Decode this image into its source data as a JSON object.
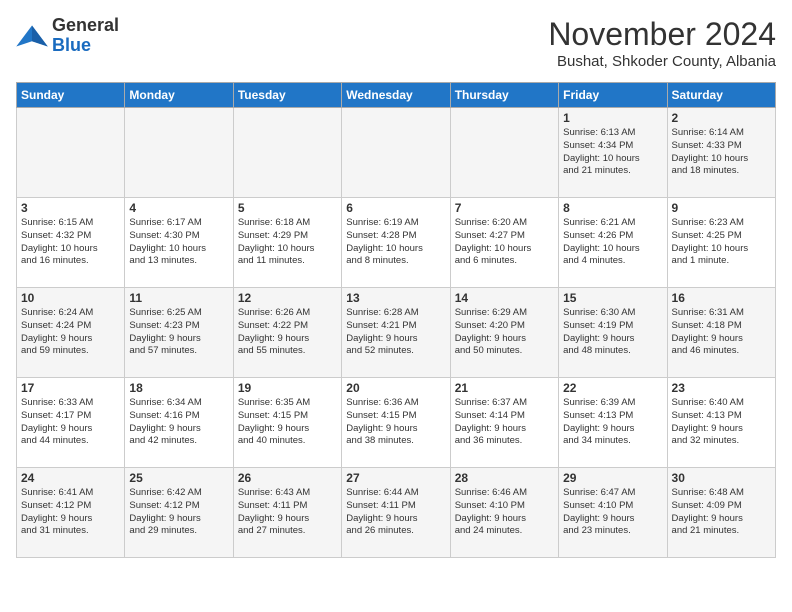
{
  "header": {
    "logo_line1": "General",
    "logo_line2": "Blue",
    "month_year": "November 2024",
    "location": "Bushat, Shkoder County, Albania"
  },
  "days_of_week": [
    "Sunday",
    "Monday",
    "Tuesday",
    "Wednesday",
    "Thursday",
    "Friday",
    "Saturday"
  ],
  "weeks": [
    [
      {
        "day": "",
        "info": ""
      },
      {
        "day": "",
        "info": ""
      },
      {
        "day": "",
        "info": ""
      },
      {
        "day": "",
        "info": ""
      },
      {
        "day": "",
        "info": ""
      },
      {
        "day": "1",
        "info": "Sunrise: 6:13 AM\nSunset: 4:34 PM\nDaylight: 10 hours\nand 21 minutes."
      },
      {
        "day": "2",
        "info": "Sunrise: 6:14 AM\nSunset: 4:33 PM\nDaylight: 10 hours\nand 18 minutes."
      }
    ],
    [
      {
        "day": "3",
        "info": "Sunrise: 6:15 AM\nSunset: 4:32 PM\nDaylight: 10 hours\nand 16 minutes."
      },
      {
        "day": "4",
        "info": "Sunrise: 6:17 AM\nSunset: 4:30 PM\nDaylight: 10 hours\nand 13 minutes."
      },
      {
        "day": "5",
        "info": "Sunrise: 6:18 AM\nSunset: 4:29 PM\nDaylight: 10 hours\nand 11 minutes."
      },
      {
        "day": "6",
        "info": "Sunrise: 6:19 AM\nSunset: 4:28 PM\nDaylight: 10 hours\nand 8 minutes."
      },
      {
        "day": "7",
        "info": "Sunrise: 6:20 AM\nSunset: 4:27 PM\nDaylight: 10 hours\nand 6 minutes."
      },
      {
        "day": "8",
        "info": "Sunrise: 6:21 AM\nSunset: 4:26 PM\nDaylight: 10 hours\nand 4 minutes."
      },
      {
        "day": "9",
        "info": "Sunrise: 6:23 AM\nSunset: 4:25 PM\nDaylight: 10 hours\nand 1 minute."
      }
    ],
    [
      {
        "day": "10",
        "info": "Sunrise: 6:24 AM\nSunset: 4:24 PM\nDaylight: 9 hours\nand 59 minutes."
      },
      {
        "day": "11",
        "info": "Sunrise: 6:25 AM\nSunset: 4:23 PM\nDaylight: 9 hours\nand 57 minutes."
      },
      {
        "day": "12",
        "info": "Sunrise: 6:26 AM\nSunset: 4:22 PM\nDaylight: 9 hours\nand 55 minutes."
      },
      {
        "day": "13",
        "info": "Sunrise: 6:28 AM\nSunset: 4:21 PM\nDaylight: 9 hours\nand 52 minutes."
      },
      {
        "day": "14",
        "info": "Sunrise: 6:29 AM\nSunset: 4:20 PM\nDaylight: 9 hours\nand 50 minutes."
      },
      {
        "day": "15",
        "info": "Sunrise: 6:30 AM\nSunset: 4:19 PM\nDaylight: 9 hours\nand 48 minutes."
      },
      {
        "day": "16",
        "info": "Sunrise: 6:31 AM\nSunset: 4:18 PM\nDaylight: 9 hours\nand 46 minutes."
      }
    ],
    [
      {
        "day": "17",
        "info": "Sunrise: 6:33 AM\nSunset: 4:17 PM\nDaylight: 9 hours\nand 44 minutes."
      },
      {
        "day": "18",
        "info": "Sunrise: 6:34 AM\nSunset: 4:16 PM\nDaylight: 9 hours\nand 42 minutes."
      },
      {
        "day": "19",
        "info": "Sunrise: 6:35 AM\nSunset: 4:15 PM\nDaylight: 9 hours\nand 40 minutes."
      },
      {
        "day": "20",
        "info": "Sunrise: 6:36 AM\nSunset: 4:15 PM\nDaylight: 9 hours\nand 38 minutes."
      },
      {
        "day": "21",
        "info": "Sunrise: 6:37 AM\nSunset: 4:14 PM\nDaylight: 9 hours\nand 36 minutes."
      },
      {
        "day": "22",
        "info": "Sunrise: 6:39 AM\nSunset: 4:13 PM\nDaylight: 9 hours\nand 34 minutes."
      },
      {
        "day": "23",
        "info": "Sunrise: 6:40 AM\nSunset: 4:13 PM\nDaylight: 9 hours\nand 32 minutes."
      }
    ],
    [
      {
        "day": "24",
        "info": "Sunrise: 6:41 AM\nSunset: 4:12 PM\nDaylight: 9 hours\nand 31 minutes."
      },
      {
        "day": "25",
        "info": "Sunrise: 6:42 AM\nSunset: 4:12 PM\nDaylight: 9 hours\nand 29 minutes."
      },
      {
        "day": "26",
        "info": "Sunrise: 6:43 AM\nSunset: 4:11 PM\nDaylight: 9 hours\nand 27 minutes."
      },
      {
        "day": "27",
        "info": "Sunrise: 6:44 AM\nSunset: 4:11 PM\nDaylight: 9 hours\nand 26 minutes."
      },
      {
        "day": "28",
        "info": "Sunrise: 6:46 AM\nSunset: 4:10 PM\nDaylight: 9 hours\nand 24 minutes."
      },
      {
        "day": "29",
        "info": "Sunrise: 6:47 AM\nSunset: 4:10 PM\nDaylight: 9 hours\nand 23 minutes."
      },
      {
        "day": "30",
        "info": "Sunrise: 6:48 AM\nSunset: 4:09 PM\nDaylight: 9 hours\nand 21 minutes."
      }
    ]
  ]
}
